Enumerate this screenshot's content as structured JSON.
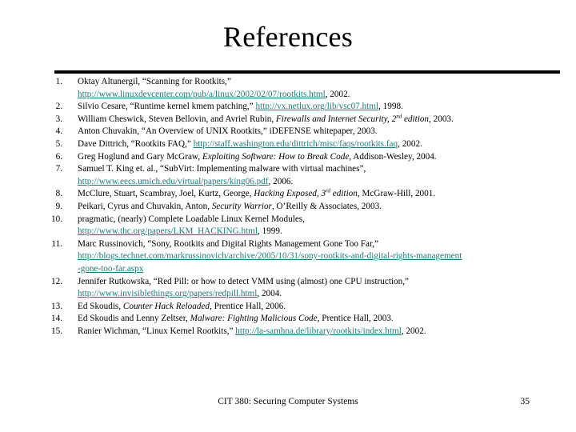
{
  "slide": {
    "title": "References",
    "footer_text": "CIT 380: Securing Computer Systems",
    "page_number": "35",
    "link_color": "#1f7a7a",
    "text_color": "#000000",
    "background_color": "#ffffff"
  },
  "references": [
    {
      "number": "1.",
      "lines": [
        [
          {
            "t": "text",
            "v": "Oktay Altunergil, “Scanning for Rootkits,”"
          }
        ],
        [
          {
            "t": "link",
            "v": "http://www.linuxdevcenter.com/pub/a/linux/2002/02/07/rootkits.html"
          },
          {
            "t": "text",
            "v": ", 2002."
          }
        ]
      ]
    },
    {
      "number": "2.",
      "lines": [
        [
          {
            "t": "text",
            "v": "Silvio Cesare, “Runtime kernel kmem patching,” "
          },
          {
            "t": "link",
            "v": "http://vx.netlux.org/lib/vsc07.html"
          },
          {
            "t": "text",
            "v": ", 1998."
          }
        ]
      ]
    },
    {
      "number": "3.",
      "lines": [
        [
          {
            "t": "text",
            "v": "William Cheswick, Steven Bellovin, and Avriel Rubin, "
          },
          {
            "t": "ital",
            "v": "Firewalls and Internet Security, 2"
          },
          {
            "t": "ital-sup",
            "v": "nd"
          },
          {
            "t": "ital",
            "v": " edition"
          },
          {
            "t": "text",
            "v": ", 2003."
          }
        ]
      ]
    },
    {
      "number": "4.",
      "lines": [
        [
          {
            "t": "text",
            "v": "Anton Chuvakin, “An Overview of UNIX Rootkits,” iDEFENSE whitepaper, 2003."
          }
        ]
      ]
    },
    {
      "number": "5.",
      "lines": [
        [
          {
            "t": "text",
            "v": "Dave Dittrich, “Rootkits FAQ,” "
          },
          {
            "t": "link",
            "v": "http://staff.washington.edu/dittrich/misc/faqs/rootkits.faq"
          },
          {
            "t": "text",
            "v": ", 2002."
          }
        ]
      ]
    },
    {
      "number": "6.",
      "lines": [
        [
          {
            "t": "text",
            "v": "Greg Hoglund and Gary McGraw, "
          },
          {
            "t": "ital",
            "v": "Exploiting Software: How to Break Code"
          },
          {
            "t": "text",
            "v": ", Addison-Wesley, 2004."
          }
        ]
      ]
    },
    {
      "number": "7.",
      "lines": [
        [
          {
            "t": "text",
            "v": "Samuel T. King et. al., “SubVirt: Implementing malware with virtual machines”,"
          }
        ],
        [
          {
            "t": "link",
            "v": "http://www.eecs.umich.edu/virtual/papers/king06.pdf"
          },
          {
            "t": "text",
            "v": ", 2006."
          }
        ]
      ]
    },
    {
      "number": "8.",
      "lines": [
        [
          {
            "t": "text",
            "v": "McClure, Stuart, Scambray, Joel, Kurtz, George, "
          },
          {
            "t": "ital",
            "v": "Hacking Exposed, 3"
          },
          {
            "t": "ital-sup",
            "v": "rd"
          },
          {
            "t": "ital",
            "v": " edition"
          },
          {
            "t": "text",
            "v": ", McGraw-Hill, 2001."
          }
        ]
      ]
    },
    {
      "number": "9.",
      "lines": [
        [
          {
            "t": "text",
            "v": "Peikari, Cyrus and Chuvakin, Anton, "
          },
          {
            "t": "ital",
            "v": "Security Warrior"
          },
          {
            "t": "text",
            "v": ", O’Reilly & Associates, 2003."
          }
        ]
      ]
    },
    {
      "number": "10.",
      "lines": [
        [
          {
            "t": "text",
            "v": "pragmatic, (nearly) Complete Loadable Linux Kernel Modules,"
          }
        ],
        [
          {
            "t": "link",
            "v": "http://www.thc.org/papers/LKM_HACKING.html"
          },
          {
            "t": "text",
            "v": ", 1999."
          }
        ]
      ]
    },
    {
      "number": "11.",
      "lines": [
        [
          {
            "t": "text",
            "v": "Marc Russinovich, “Sony, Rootkits and Digital Rights Management Gone Too Far,”"
          }
        ],
        [
          {
            "t": "link",
            "v": "http://blogs.technet.com/markrussinovich/archive/2005/10/31/sony-rootkits-and-digital-rights-management"
          }
        ],
        [
          {
            "t": "link",
            "v": "-gone-too-far.aspx"
          }
        ]
      ]
    },
    {
      "number": "12.",
      "lines": [
        [
          {
            "t": "text",
            "v": "Jennifer Rutkowska, “Red Pill: or how to detect VMM using (almost) one CPU instruction,”"
          }
        ],
        [
          {
            "t": "link",
            "v": "http://www.invisiblethings.org/papers/redpill.html"
          },
          {
            "t": "text",
            "v": ", 2004."
          }
        ]
      ]
    },
    {
      "number": "13.",
      "lines": [
        [
          {
            "t": "text",
            "v": "Ed Skoudis, "
          },
          {
            "t": "ital",
            "v": "Counter Hack Reloaded"
          },
          {
            "t": "text",
            "v": ", Prentice Hall, 2006."
          }
        ]
      ]
    },
    {
      "number": "14.",
      "lines": [
        [
          {
            "t": "text",
            "v": "Ed Skoudis and Lenny Zeltser, "
          },
          {
            "t": "ital",
            "v": "Malware: Fighting Malicious Code"
          },
          {
            "t": "text",
            "v": ", Prentice Hall, 2003."
          }
        ]
      ]
    },
    {
      "number": "15.",
      "lines": [
        [
          {
            "t": "text",
            "v": "Ranier Wichman, “Linux Kernel Rootkits,” "
          },
          {
            "t": "link",
            "v": "http://la-samhna.de/library/rootkits/index.html"
          },
          {
            "t": "text",
            "v": ", 2002."
          }
        ]
      ]
    }
  ]
}
